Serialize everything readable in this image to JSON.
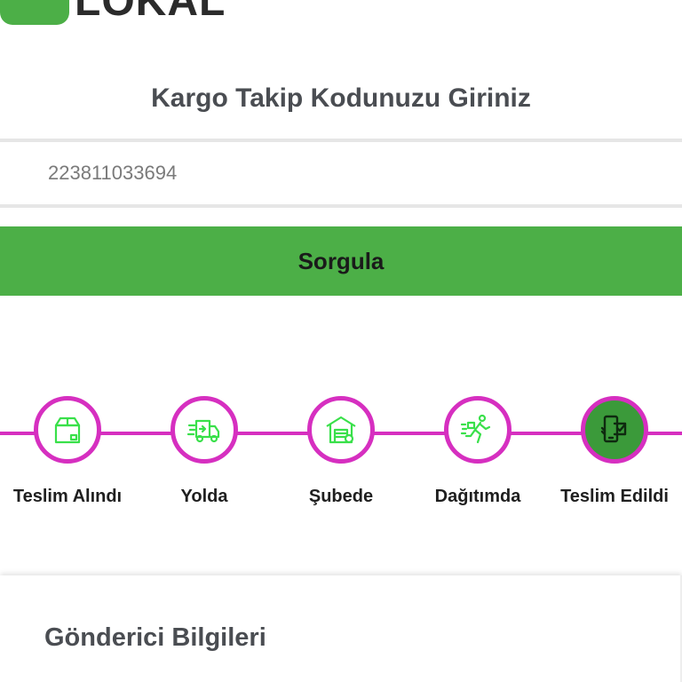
{
  "header": {
    "logo_text": "LOKAL",
    "brand_color": "#4caf47"
  },
  "search": {
    "heading": "Kargo Takip Kodunuzu Giriniz",
    "value": "223811033694",
    "button_label": "Sorgula"
  },
  "progress": {
    "line_color": "#d62fc0",
    "steps": [
      {
        "label": "Teslim Alındı",
        "icon": "package-box-icon",
        "active": false
      },
      {
        "label": "Yolda",
        "icon": "delivery-truck-icon",
        "active": false
      },
      {
        "label": "Şubede",
        "icon": "warehouse-icon",
        "active": false
      },
      {
        "label": "Dağıtımda",
        "icon": "running-courier-icon",
        "active": false
      },
      {
        "label": "Teslim Edildi",
        "icon": "phone-delivered-icon",
        "active": true
      }
    ]
  },
  "sender_card": {
    "title": "Gönderici Bilgileri"
  }
}
